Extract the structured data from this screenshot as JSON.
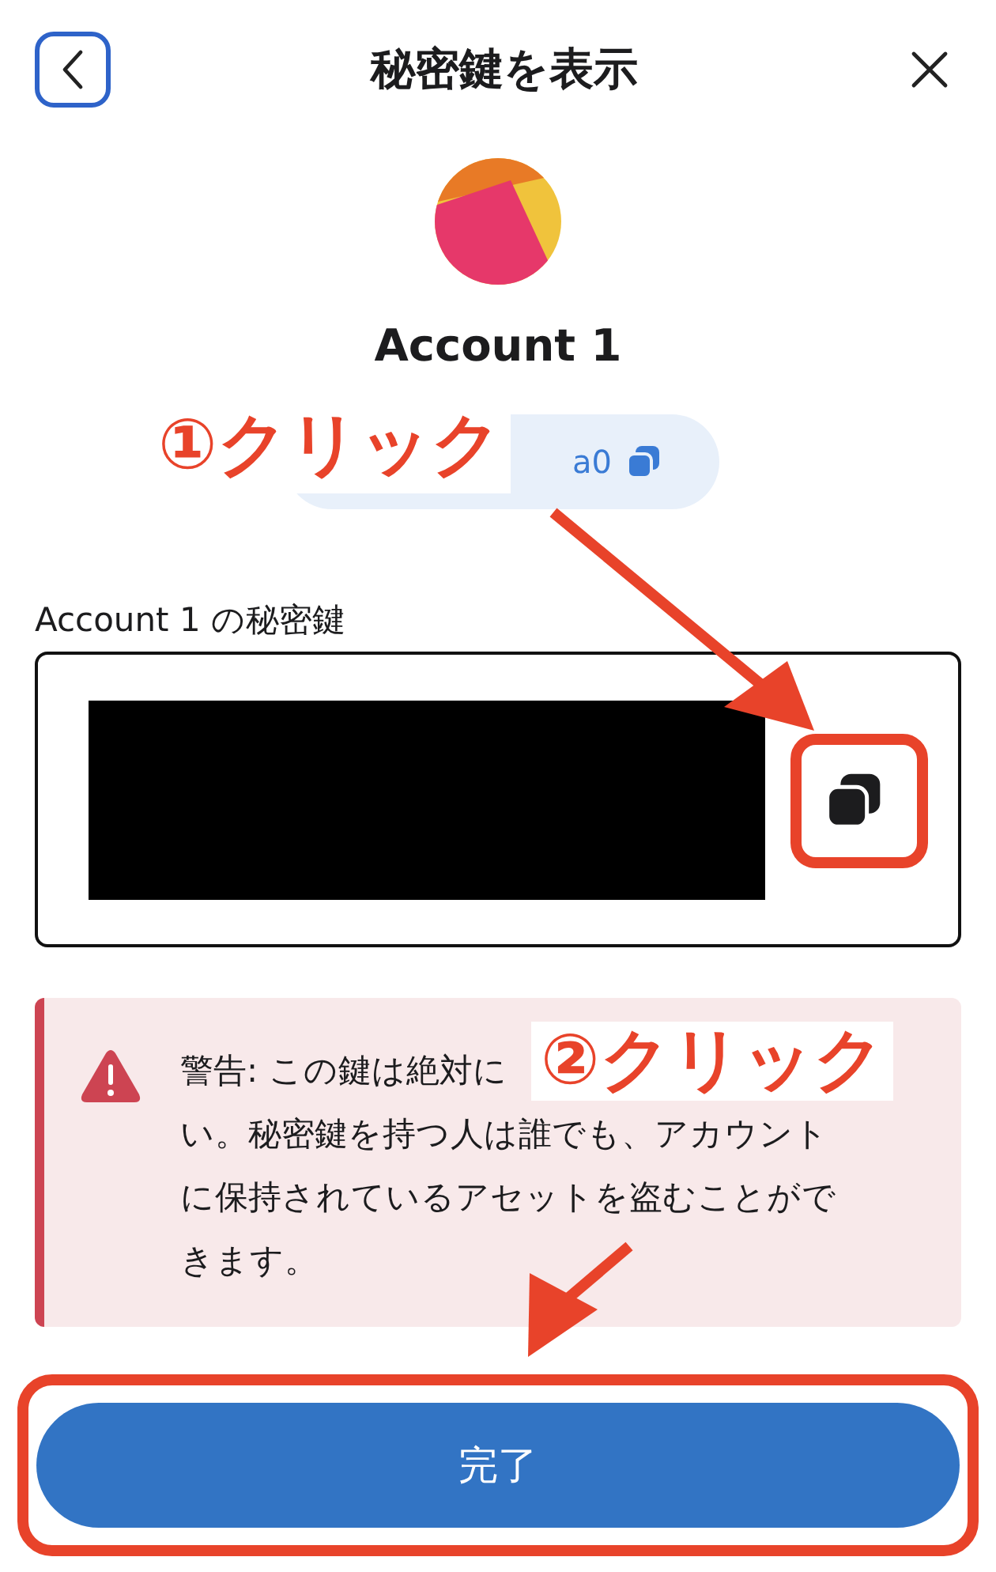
{
  "header": {
    "title": "秘密鍵を表示"
  },
  "account": {
    "name": "Account 1",
    "address": "a0"
  },
  "private_key": {
    "label": "Account 1 の秘密鍵",
    "copy_highlighted": true
  },
  "warning": {
    "lines": [
      "警告: この鍵は絶対に",
      "い。秘密鍵を持つ人は誰でも、アカウント",
      "に保持されているアセットを盗むことがで",
      "きます。"
    ]
  },
  "done_button": {
    "label": "完了",
    "highlighted": true
  },
  "annotations": [
    {
      "text": "①クリック"
    },
    {
      "text": "②クリック"
    }
  ]
}
